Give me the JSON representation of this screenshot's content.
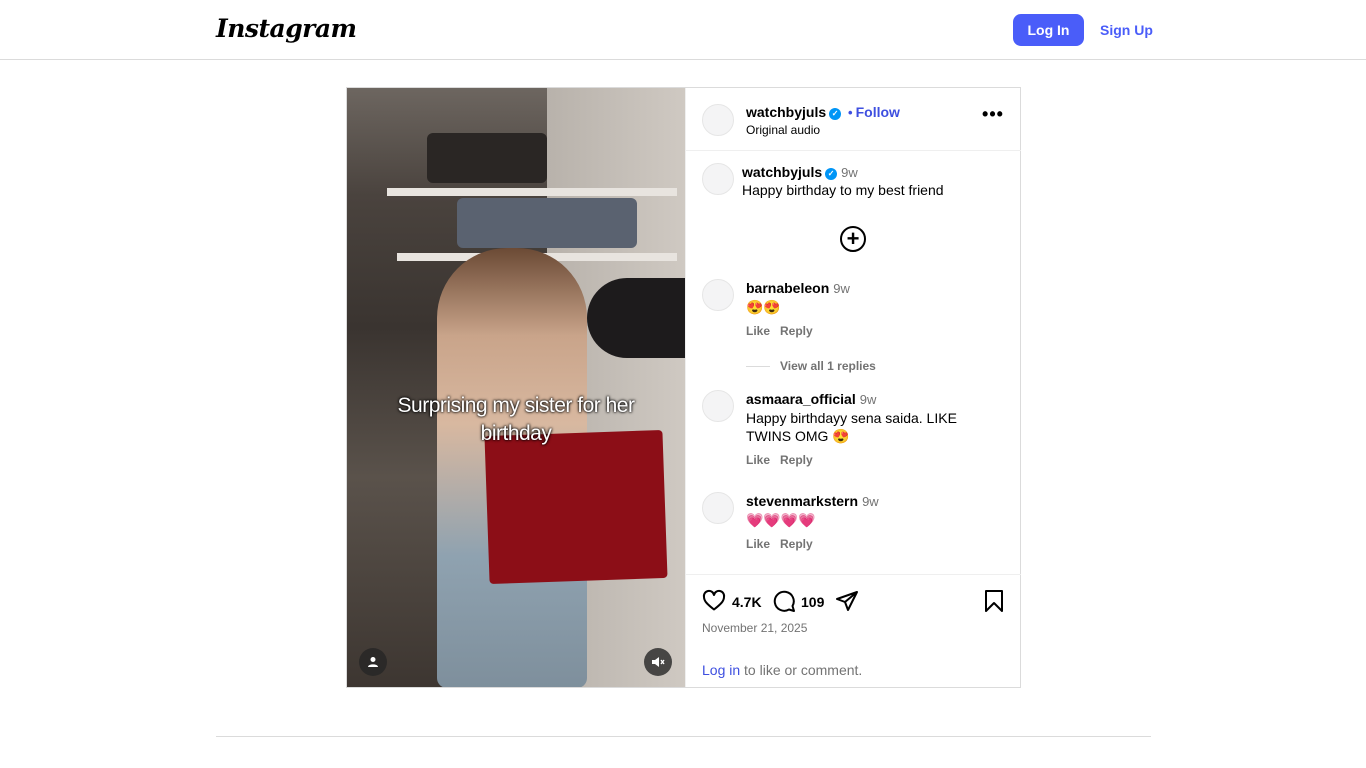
{
  "nav": {
    "logo": "Instagram",
    "login_label": "Log In",
    "signup_label": "Sign Up"
  },
  "media": {
    "overlay_text": "Surprising my sister for her birthday",
    "user_tag_icon": "person-icon",
    "mute_icon": "speaker-muted-icon"
  },
  "post": {
    "author": "watchbyjuls",
    "separator": "•",
    "follow_label": "Follow",
    "audio": "Original audio",
    "more_icon": "•••",
    "caption": {
      "author": "watchbyjuls",
      "time": "9w",
      "text": "Happy birthday to my best friend"
    },
    "comments": [
      {
        "author": "barnabeleon",
        "time": "9w",
        "text": "😍😍",
        "like": "Like",
        "reply": "Reply"
      },
      {
        "author": "asmaara_official",
        "time": "9w",
        "text": "Happy birthdayy sena saida. LIKE TWINS OMG 😍",
        "like": "Like",
        "reply": "Reply"
      },
      {
        "author": "stevenmarkstern",
        "time": "9w",
        "text": "💗💗💗💗",
        "like": "Like",
        "reply": "Reply"
      }
    ],
    "view_replies": "View all 1 replies",
    "likes": "4.7K",
    "comment_count": "109",
    "date": "November 21, 2025",
    "login_link": "Log in",
    "login_suffix": " to like or comment."
  },
  "colors": {
    "accent": "#4a5df9",
    "link": "#3e4fe0",
    "verified": "#0095f6",
    "muted_text": "#737373",
    "border": "#dbdbdb"
  }
}
